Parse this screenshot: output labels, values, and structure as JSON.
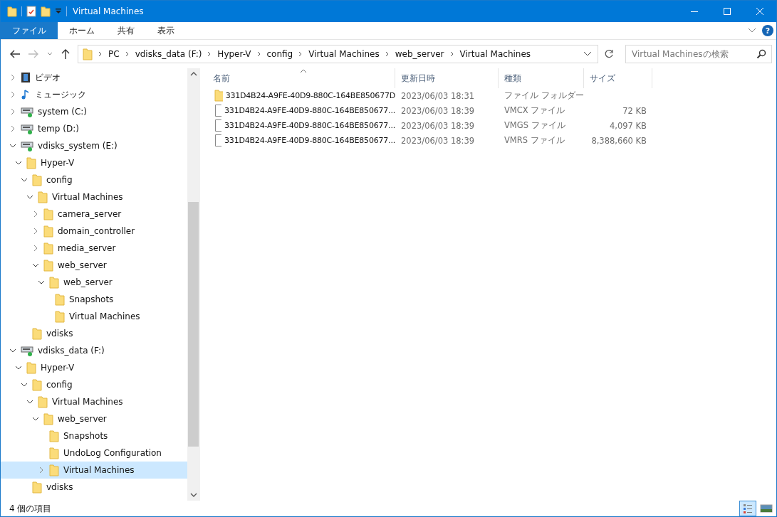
{
  "window": {
    "title": "Virtual Machines"
  },
  "ribbon_tabs": [
    {
      "label": "ファイル",
      "selected": true
    },
    {
      "label": "ホーム",
      "selected": false
    },
    {
      "label": "共有",
      "selected": false
    },
    {
      "label": "表示",
      "selected": false
    }
  ],
  "help": "?",
  "address": {
    "segments": [
      "PC",
      "vdisks_data (F:)",
      "Hyper-V",
      "config",
      "Virtual Machines",
      "web_server",
      "Virtual Machines"
    ]
  },
  "search": {
    "placeholder": "Virtual Machinesの検索"
  },
  "tree": [
    {
      "label": "ビデオ",
      "kind": "video",
      "expandable": true,
      "expanded": false,
      "selected": false
    },
    {
      "label": "ミュージック",
      "kind": "music",
      "expandable": true,
      "expanded": false,
      "selected": false
    },
    {
      "label": "system (C:)",
      "kind": "drive",
      "expandable": true,
      "expanded": false,
      "selected": false
    },
    {
      "label": "temp (D:)",
      "kind": "drive",
      "expandable": true,
      "expanded": false,
      "selected": false
    },
    {
      "label": "vdisks_system (E:)",
      "kind": "drive",
      "expandable": true,
      "expanded": true,
      "selected": false,
      "children": [
        {
          "label": "Hyper-V",
          "kind": "folder",
          "expandable": true,
          "expanded": true,
          "selected": false,
          "children": [
            {
              "label": "config",
              "kind": "folder",
              "expandable": true,
              "expanded": true,
              "selected": false,
              "children": [
                {
                  "label": "Virtual Machines",
                  "kind": "folder",
                  "expandable": true,
                  "expanded": true,
                  "selected": false,
                  "children": [
                    {
                      "label": "camera_server",
                      "kind": "folder",
                      "expandable": true,
                      "expanded": false,
                      "selected": false
                    },
                    {
                      "label": "domain_controller",
                      "kind": "folder",
                      "expandable": true,
                      "expanded": false,
                      "selected": false
                    },
                    {
                      "label": "media_server",
                      "kind": "folder",
                      "expandable": true,
                      "expanded": false,
                      "selected": false
                    },
                    {
                      "label": "web_server",
                      "kind": "folder",
                      "expandable": true,
                      "expanded": true,
                      "selected": false,
                      "children": [
                        {
                          "label": "web_server",
                          "kind": "folder",
                          "expandable": true,
                          "expanded": true,
                          "selected": false,
                          "children": [
                            {
                              "label": "Snapshots",
                              "kind": "folder",
                              "expandable": false,
                              "expanded": false,
                              "selected": false
                            },
                            {
                              "label": "Virtual Machines",
                              "kind": "folder",
                              "expandable": false,
                              "expanded": false,
                              "selected": false
                            }
                          ]
                        }
                      ]
                    }
                  ]
                }
              ]
            },
            {
              "label": "vdisks",
              "kind": "folder",
              "expandable": false,
              "expanded": false,
              "selected": false
            }
          ]
        }
      ]
    },
    {
      "label": "vdisks_data (F:)",
      "kind": "drive",
      "expandable": true,
      "expanded": true,
      "selected": false,
      "children": [
        {
          "label": "Hyper-V",
          "kind": "folder",
          "expandable": true,
          "expanded": true,
          "selected": false,
          "children": [
            {
              "label": "config",
              "kind": "folder",
              "expandable": true,
              "expanded": true,
              "selected": false,
              "children": [
                {
                  "label": "Virtual Machines",
                  "kind": "folder",
                  "expandable": true,
                  "expanded": true,
                  "selected": false,
                  "children": [
                    {
                      "label": "web_server",
                      "kind": "folder",
                      "expandable": true,
                      "expanded": true,
                      "selected": false,
                      "children": [
                        {
                          "label": "Snapshots",
                          "kind": "folder",
                          "expandable": false,
                          "expanded": false,
                          "selected": false
                        },
                        {
                          "label": "UndoLog Configuration",
                          "kind": "folder",
                          "expandable": false,
                          "expanded": false,
                          "selected": false
                        },
                        {
                          "label": "Virtual Machines",
                          "kind": "folder",
                          "expandable": true,
                          "expanded": false,
                          "selected": true
                        }
                      ]
                    }
                  ]
                }
              ]
            },
            {
              "label": "vdisks",
              "kind": "folder",
              "expandable": false,
              "expanded": false,
              "selected": false
            }
          ]
        }
      ]
    }
  ],
  "table": {
    "columns": [
      "名前",
      "更新日時",
      "種類",
      "サイズ"
    ],
    "rows": [
      {
        "kind": "folder",
        "name": "331D4B24-A9FE-40D9-880C-164BE850677D",
        "modified": "2023/06/03 18:31",
        "type": "ファイル フォルダー",
        "size": ""
      },
      {
        "kind": "file",
        "name": "331D4B24-A9FE-40D9-880C-164BE850677...",
        "modified": "2023/06/03 18:39",
        "type": "VMCX ファイル",
        "size": "72 KB"
      },
      {
        "kind": "file",
        "name": "331D4B24-A9FE-40D9-880C-164BE850677...",
        "modified": "2023/06/03 18:39",
        "type": "VMGS ファイル",
        "size": "4,097 KB"
      },
      {
        "kind": "file",
        "name": "331D4B24-A9FE-40D9-880C-164BE850677...",
        "modified": "2023/06/03 18:39",
        "type": "VMRS ファイル",
        "size": "8,388,660 KB"
      }
    ]
  },
  "status_bar": {
    "text": "4 個の項目",
    "views": [
      {
        "kind": "details",
        "selected": true
      },
      {
        "kind": "thumbnails",
        "selected": false
      }
    ]
  }
}
